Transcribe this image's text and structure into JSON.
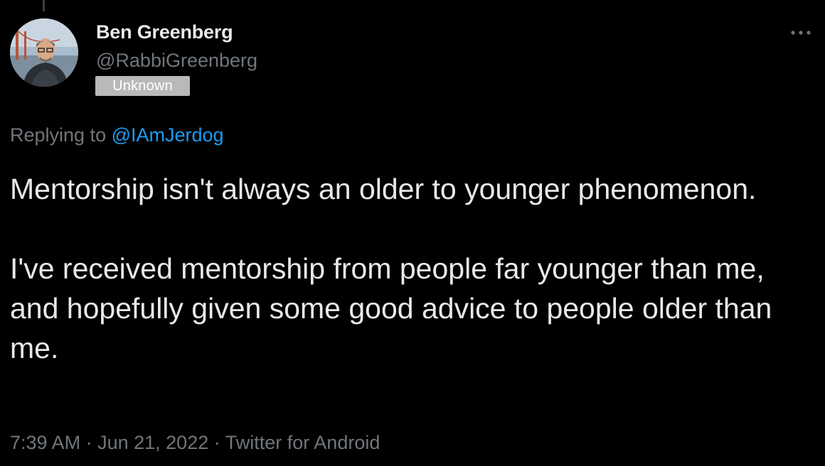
{
  "author": {
    "name": "Ben Greenberg",
    "handle": "@RabbiGreenberg",
    "badge": "Unknown"
  },
  "reply": {
    "prefix": "Replying to",
    "mention": "@IAmJerdog"
  },
  "tweet": {
    "paragraph_1": "Mentorship isn't always an older to younger phenomenon.",
    "paragraph_2": "I've received mentorship from people far younger than me, and hopefully given some good advice to people older than me."
  },
  "meta": {
    "time": "7:39 AM",
    "separator": "·",
    "date": "Jun 21, 2022",
    "source": "Twitter for Android"
  },
  "icons": {
    "more": "more-horizontal-icon"
  },
  "colors": {
    "background": "#000000",
    "primary_text": "#e7e9ea",
    "secondary_text": "#71767b",
    "link": "#1d9bf0",
    "badge_bg": "#b9b9b9"
  }
}
